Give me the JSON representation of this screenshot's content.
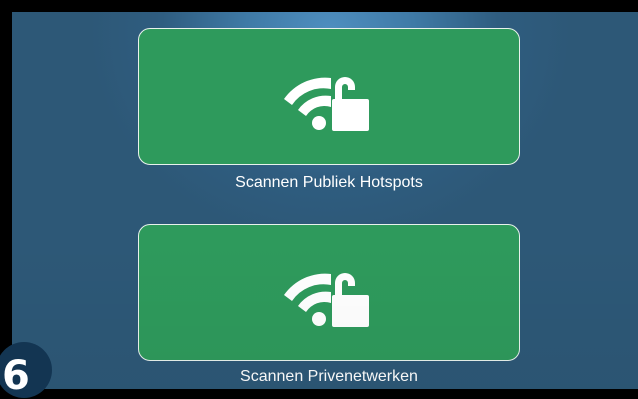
{
  "scan_options": [
    {
      "label": "Scannen Publiek Hotspots",
      "icon": "wifi-lock-icon"
    },
    {
      "label": "Scannen Privenetwerken",
      "icon": "wifi-lock-icon"
    }
  ],
  "badge": {
    "text": "6"
  },
  "colors": {
    "background": "#2f5d80",
    "glow": "#4f8fc0",
    "card": "#2e9a5c",
    "card_border": "#e8f2ec",
    "text": "#ffffff",
    "frame": "#000000",
    "badge": "#133552"
  }
}
